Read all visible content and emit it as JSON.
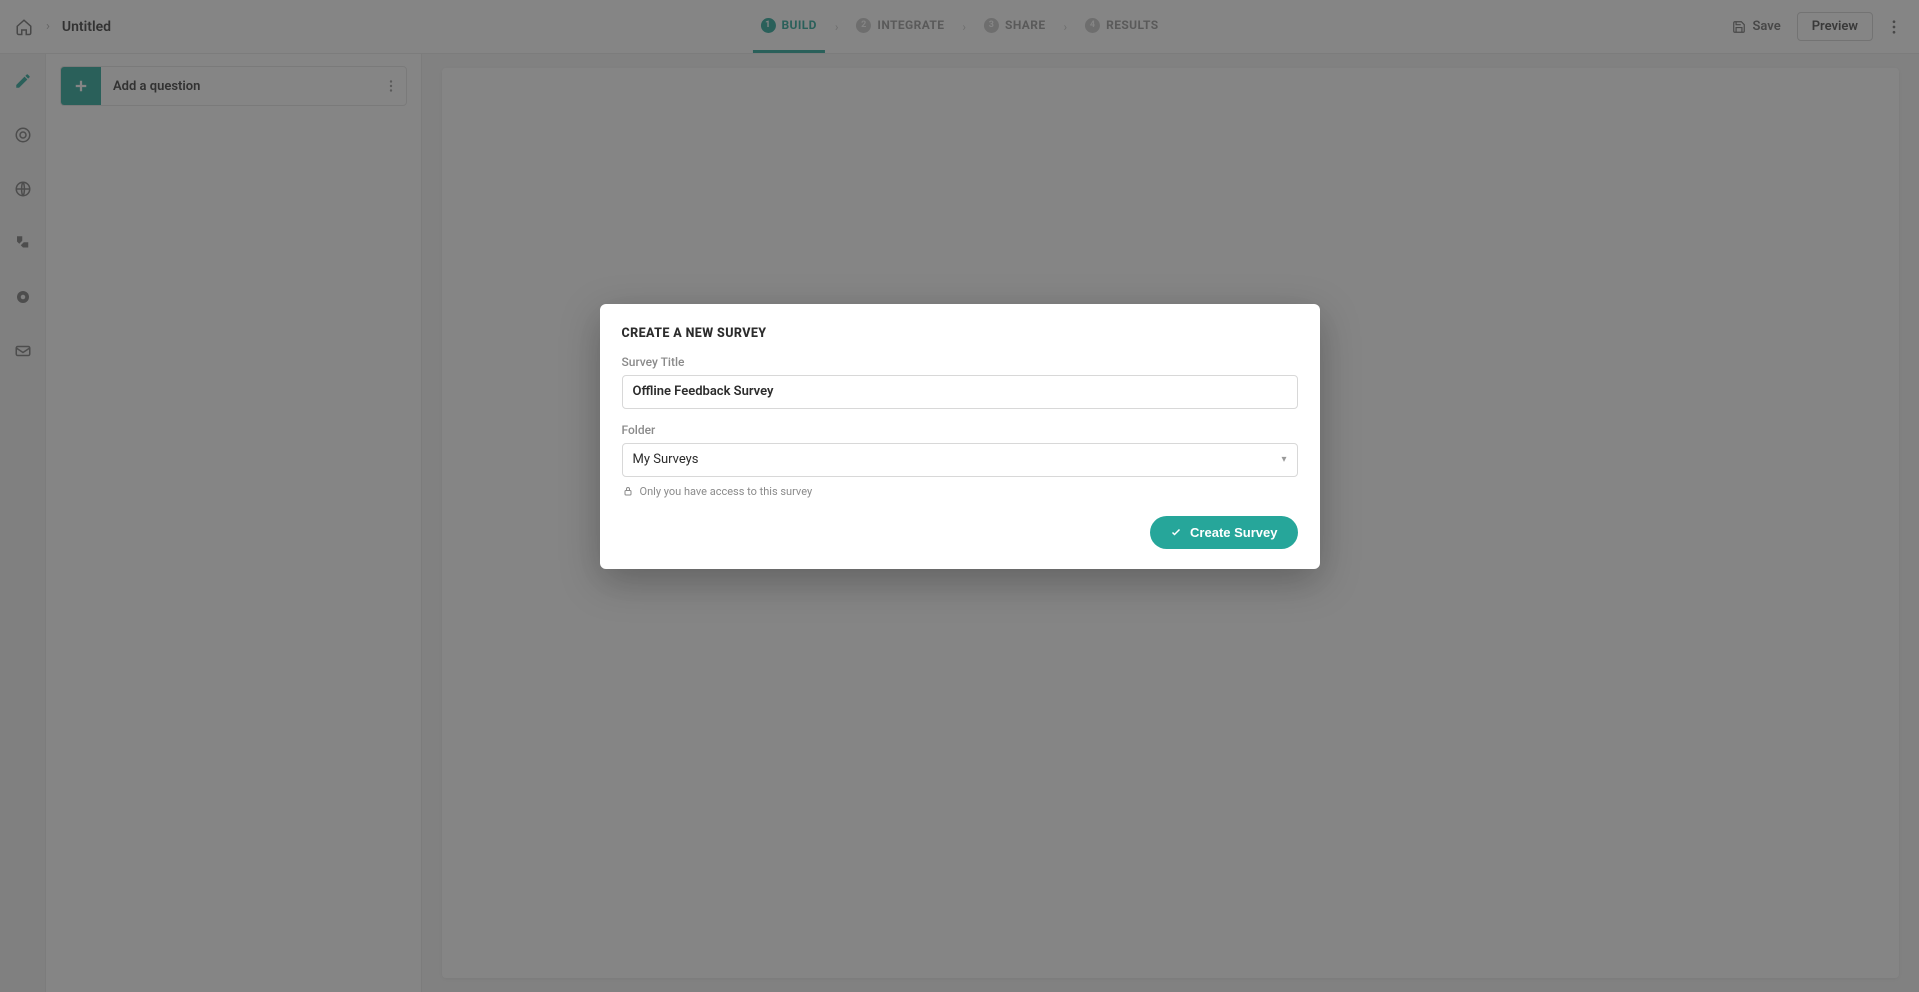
{
  "header": {
    "breadcrumb_title": "Untitled",
    "steps": [
      {
        "num": "1",
        "label": "BUILD",
        "active": true
      },
      {
        "num": "2",
        "label": "INTEGRATE",
        "active": false
      },
      {
        "num": "3",
        "label": "SHARE",
        "active": false
      },
      {
        "num": "4",
        "label": "RESULTS",
        "active": false
      }
    ],
    "save_label": "Save",
    "preview_label": "Preview"
  },
  "side_rail": {
    "items": [
      {
        "name": "edit-icon",
        "active": true
      },
      {
        "name": "target-icon",
        "active": false
      },
      {
        "name": "globe-icon",
        "active": false
      },
      {
        "name": "translate-icon",
        "active": false
      },
      {
        "name": "settings-badge-icon",
        "active": false
      },
      {
        "name": "email-icon",
        "active": false
      }
    ]
  },
  "question_panel": {
    "add_label": "Add a question"
  },
  "modal": {
    "title": "CREATE A NEW SURVEY",
    "title_label": "Survey Title",
    "title_value": "Offline Feedback Survey",
    "folder_label": "Folder",
    "folder_value": "My Surveys",
    "access_hint": "Only you have access to this survey",
    "submit_label": "Create Survey"
  }
}
